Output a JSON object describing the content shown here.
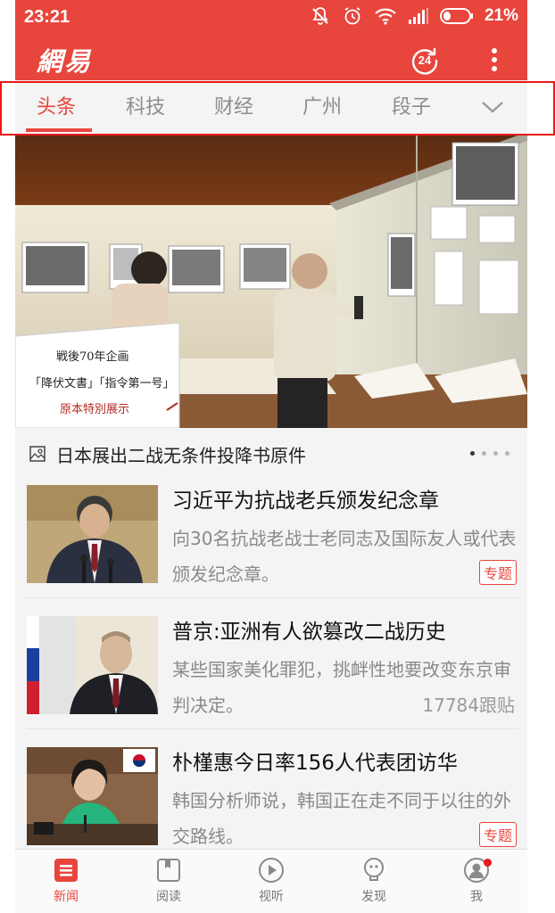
{
  "status_bar": {
    "time": "23:21",
    "battery_percent": "21%",
    "icons": [
      "mute-icon",
      "alarm-icon",
      "wifi-icon",
      "signal-icon",
      "battery-icon"
    ]
  },
  "app_bar": {
    "logo": "網易",
    "badge_count": "24",
    "icons": [
      "refresh-badge-icon",
      "more-vert-icon"
    ]
  },
  "tabs": [
    {
      "label": "头条",
      "active": true
    },
    {
      "label": "科技",
      "active": false
    },
    {
      "label": "财经",
      "active": false
    },
    {
      "label": "广州",
      "active": false
    },
    {
      "label": "段子",
      "active": false
    }
  ],
  "hero": {
    "sign_lines": [
      "戦後70年企画",
      "「降伏文書」「指令第一号」",
      "原本特別展示"
    ],
    "caption": "日本展出二战无条件投降书原件",
    "carousel_dots": 4,
    "carousel_active": 0
  },
  "news": [
    {
      "title": "习近平为抗战老兵颁发纪念章",
      "desc": "向30名抗战老战士老同志及国际友人或代表颁发纪念章。",
      "tag": "专题"
    },
    {
      "title": "普京:亚洲有人欲篡改二战历史",
      "desc": "某些国家美化罪犯，挑衅性地要改变东京审判决定。",
      "count": "17784跟贴"
    },
    {
      "title": "朴槿惠今日率156人代表团访华",
      "desc": "韩国分析师说，韩国正在走不同于以往的外交路线。",
      "tag": "专题"
    }
  ],
  "bottom_nav": [
    {
      "label": "新闻",
      "icon": "news-icon",
      "active": true
    },
    {
      "label": "阅读",
      "icon": "reading-icon",
      "active": false
    },
    {
      "label": "视听",
      "icon": "play-icon",
      "active": false
    },
    {
      "label": "发现",
      "icon": "discover-icon",
      "active": false
    },
    {
      "label": "我",
      "icon": "profile-icon",
      "active": false,
      "notification_dot": true
    }
  ],
  "colors": {
    "brand_red": "#e8453c",
    "tab_inactive": "#8c8c8c",
    "highlight_box": "#e8191a"
  }
}
